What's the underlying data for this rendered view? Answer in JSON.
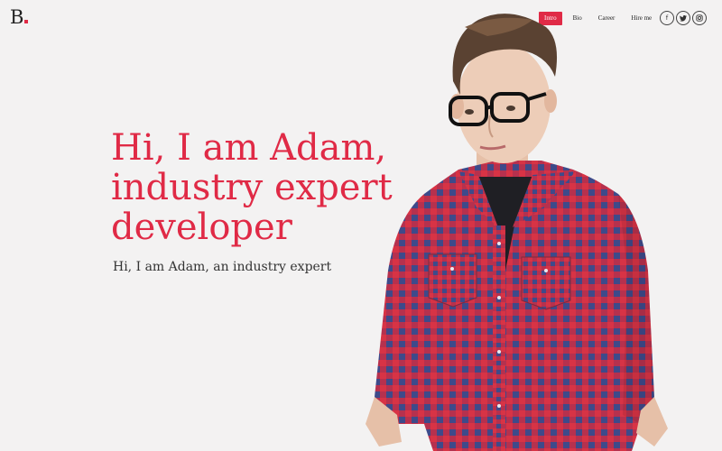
{
  "logo": {
    "letter": "B."
  },
  "nav": {
    "items": [
      {
        "label": "Intro",
        "active": true
      },
      {
        "label": "Bio",
        "active": false
      },
      {
        "label": "Career",
        "active": false
      },
      {
        "label": "Hire me",
        "active": false
      }
    ]
  },
  "social": [
    {
      "icon": "facebook-icon",
      "glyph": "f"
    },
    {
      "icon": "twitter-icon",
      "glyph": "t"
    },
    {
      "icon": "instagram-icon",
      "glyph": "◎"
    }
  ],
  "hero": {
    "headline_lines": [
      "Hi, I am Adam,",
      "industry expert",
      "developer"
    ],
    "subheading": "Hi, I am Adam, an industry expert"
  },
  "colors": {
    "accent": "#e02a46",
    "background": "#f3f2f2",
    "shirt_red": "#d83345",
    "shirt_blue": "#3e4a8a"
  }
}
